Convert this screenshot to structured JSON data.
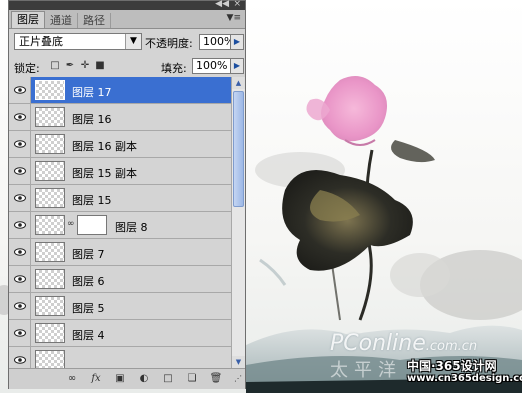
{
  "panel": {
    "tabs": [
      {
        "label": "图层",
        "active": true
      },
      {
        "label": "通道",
        "active": false
      },
      {
        "label": "路径",
        "active": false
      }
    ],
    "blend_mode": "正片叠底",
    "opacity_label": "不透明度:",
    "opacity_value": "100%",
    "lock_label": "锁定:",
    "fill_label": "填充:",
    "fill_value": "100%",
    "layers": [
      {
        "name": "图层 17",
        "selected": true,
        "has_mask": false
      },
      {
        "name": "图层 16",
        "selected": false,
        "has_mask": false
      },
      {
        "name": "图层 16 副本",
        "selected": false,
        "has_mask": false
      },
      {
        "name": "图层 15 副本",
        "selected": false,
        "has_mask": false
      },
      {
        "name": "图层 15",
        "selected": false,
        "has_mask": false
      },
      {
        "name": "图层 8",
        "selected": false,
        "has_mask": true
      },
      {
        "name": "图层 7",
        "selected": false,
        "has_mask": false
      },
      {
        "name": "图层 6",
        "selected": false,
        "has_mask": false
      },
      {
        "name": "图层 5",
        "selected": false,
        "has_mask": false
      },
      {
        "name": "图层 4",
        "selected": false,
        "has_mask": false
      }
    ],
    "icons": {
      "collapse": "double-chevron-icon",
      "menu": "panel-menu-icon",
      "lock": [
        "lock-transparent-icon",
        "lock-brush-icon",
        "lock-move-icon",
        "lock-all-icon"
      ],
      "toolbar": [
        "link-icon",
        "fx-icon",
        "layer-mask-icon",
        "adjustment-icon",
        "group-folder-icon",
        "new-layer-icon",
        "trash-icon"
      ]
    },
    "accent_color": "#3a6fd1"
  },
  "watermarks": {
    "brand": "PConline",
    "brand_suffix": ".com.cn",
    "brand_cn": "太平洋",
    "site_cn": "中国·365设计网",
    "site_url": "www.cn365design.com"
  }
}
